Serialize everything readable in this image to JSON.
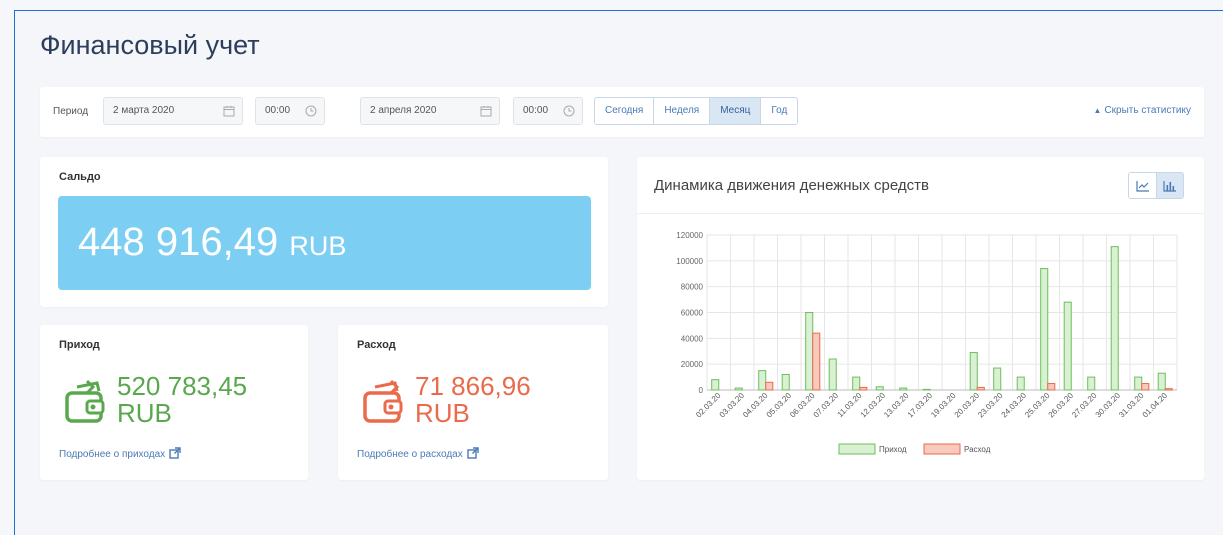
{
  "title": "Финансовый учет",
  "filter": {
    "period_label": "Период",
    "date_from": "2 марта 2020",
    "time_from": "00:00",
    "dash": "—",
    "date_to": "2 апреля 2020",
    "time_to": "00:00",
    "ranges": [
      {
        "label": "Сегодня",
        "active": false
      },
      {
        "label": "Неделя",
        "active": false
      },
      {
        "label": "Месяц",
        "active": true
      },
      {
        "label": "Год",
        "active": false
      }
    ],
    "hide_stats": "Скрыть статистику"
  },
  "balance": {
    "label": "Сальдо",
    "value": "448 916,49",
    "currency": "RUB"
  },
  "income": {
    "label": "Приход",
    "value": "520 783,45",
    "currency": "RUB",
    "link": "Подробнее о приходах",
    "color": "#5aa84e"
  },
  "expense": {
    "label": "Расход",
    "value": "71 866,96",
    "currency": "RUB",
    "link": "Подробнее о расходах",
    "color": "#ea6a4b"
  },
  "chart_panel": {
    "title": "Динамика движения денежных средств",
    "line_icon": "line-chart-icon",
    "bar_icon": "bar-chart-icon"
  },
  "chart_data": {
    "type": "bar",
    "categories": [
      "02.03.20",
      "03.03.20",
      "04.03.20",
      "05.03.20",
      "06.03.20",
      "07.03.20",
      "11.03.20",
      "12.03.20",
      "13.03.20",
      "17.03.20",
      "19.03.20",
      "20.03.20",
      "23.03.20",
      "24.03.20",
      "25.03.20",
      "26.03.20",
      "27.03.20",
      "30.03.20",
      "31.03.20",
      "01.04.20"
    ],
    "series": [
      {
        "name": "Приход",
        "values": [
          8000,
          1500,
          15000,
          12000,
          60000,
          24000,
          10000,
          2500,
          1500,
          500,
          0,
          29000,
          17000,
          10000,
          94000,
          68000,
          10000,
          111000,
          10000,
          13000
        ]
      },
      {
        "name": "Расход",
        "values": [
          0,
          0,
          6000,
          0,
          44000,
          0,
          2000,
          0,
          0,
          0,
          0,
          2000,
          0,
          0,
          5000,
          0,
          0,
          0,
          5000,
          1000
        ]
      }
    ],
    "ylim": [
      0,
      120000
    ],
    "yticks": [
      "120000",
      "100000",
      "80000",
      "60000",
      "40000",
      "20000",
      "0"
    ],
    "colors": {
      "income_fill": "#d9f0d3",
      "income_stroke": "#6cbf5c",
      "expense_fill": "#f8c9bd",
      "expense_stroke": "#ea6a4b"
    },
    "grid": true,
    "legend_position": "bottom"
  }
}
